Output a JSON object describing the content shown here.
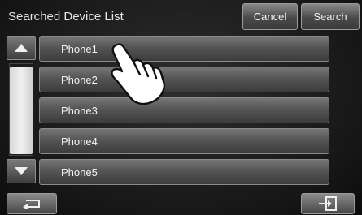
{
  "header": {
    "title": "Searched Device List",
    "cancel_label": "Cancel",
    "search_label": "Search"
  },
  "scrollbar": {
    "up_icon": "up-arrow-icon",
    "down_icon": "down-arrow-icon"
  },
  "devices": [
    "Phone1",
    "Phone2",
    "Phone3",
    "Phone4",
    "Phone5"
  ],
  "footer": {
    "back_icon": "return-arrow-icon",
    "exit_icon": "exit-door-icon"
  },
  "overlay": {
    "pointer_icon": "tap-hand-icon"
  }
}
